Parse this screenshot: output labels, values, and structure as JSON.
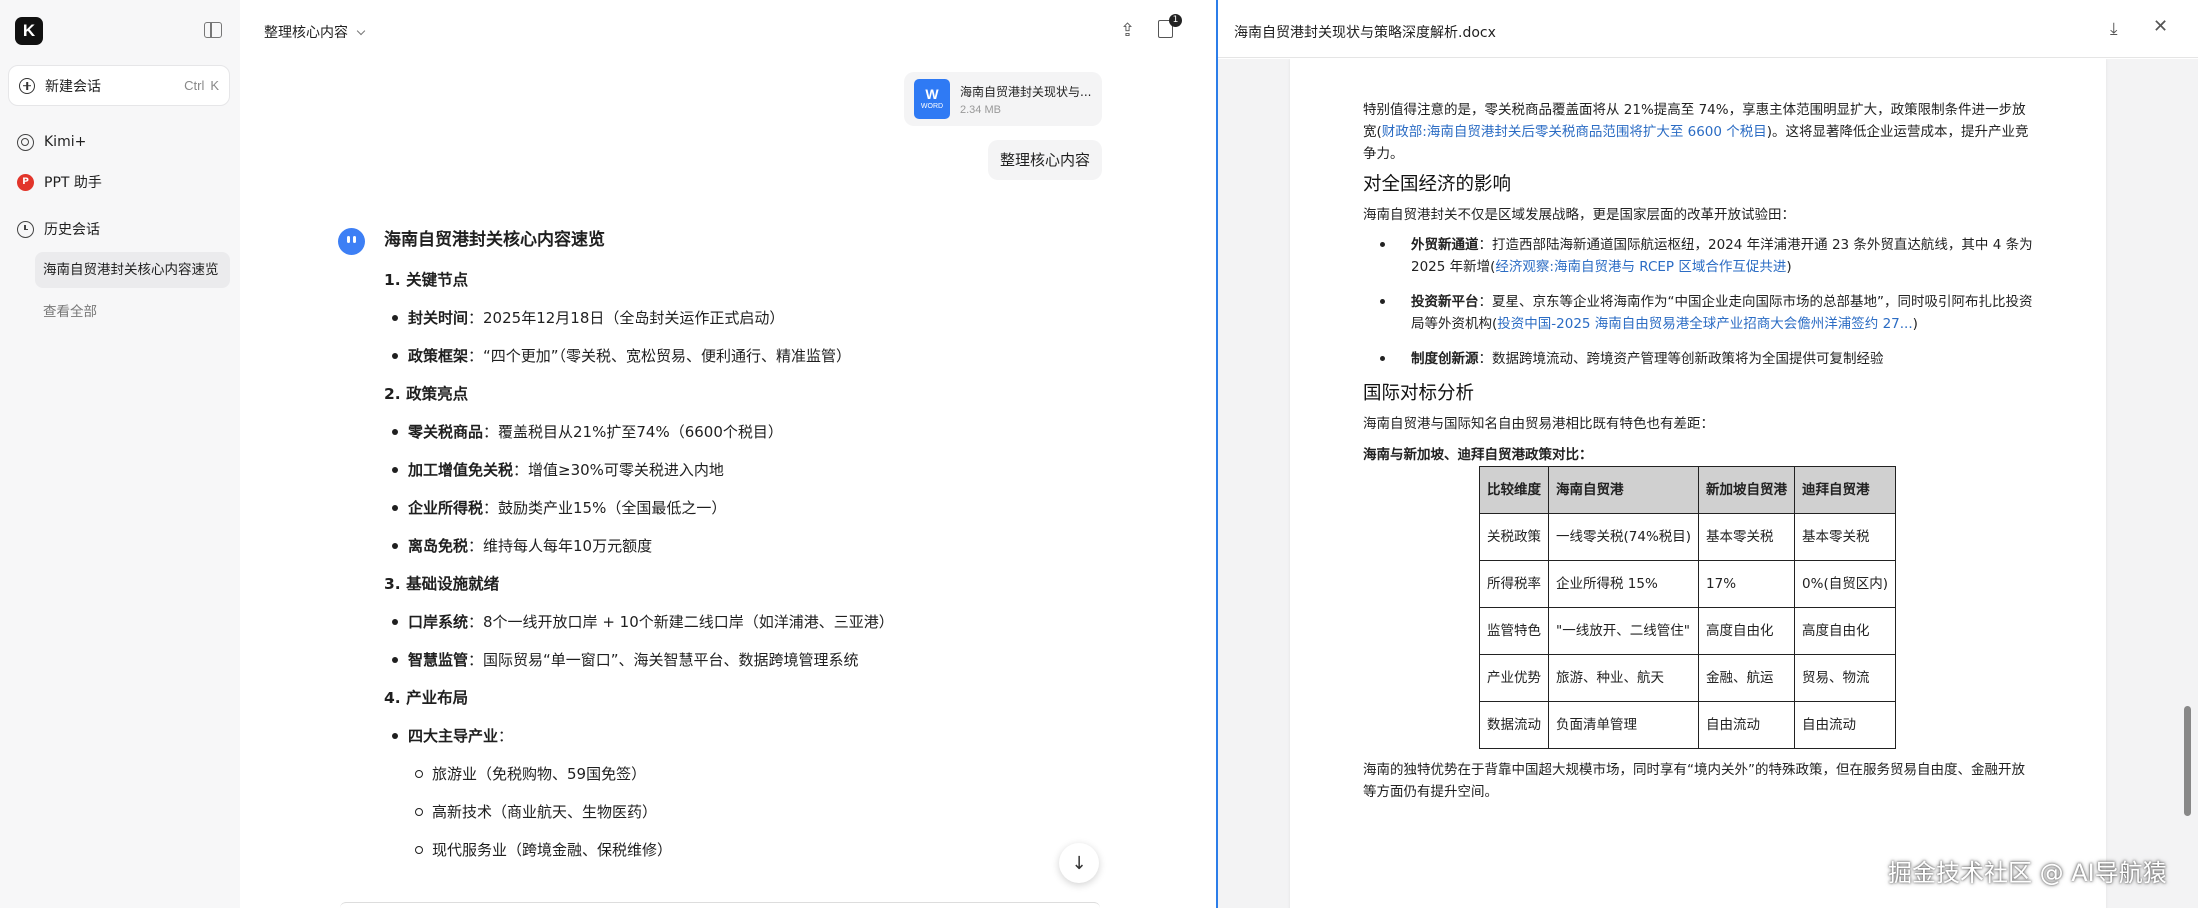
{
  "sidebar": {
    "logo": "K",
    "new_chat": {
      "label": "新建会话",
      "shortcut_mod": "Ctrl",
      "shortcut_key": "K"
    },
    "nav": [
      {
        "label": "Kimi+",
        "icon": "kimi-plus-icon"
      },
      {
        "label": "PPT 助手",
        "icon": "ppt-icon",
        "icon_glyph": "P"
      },
      {
        "label": "历史会话",
        "icon": "clock-icon"
      }
    ],
    "history_items": [
      "海南自贸港封关核心内容速览"
    ],
    "view_all": "查看全部"
  },
  "chat": {
    "title": "整理核心内容",
    "badge_count": "1",
    "file": {
      "icon_letter": "W",
      "icon_type": "WORD",
      "name": "海南自贸港封关现状与...",
      "size": "2.34 MB"
    },
    "user_message": "整理核心内容",
    "answer": {
      "title": "海南自贸港封关核心内容速览",
      "sections": [
        {
          "heading": "1. 关键节点",
          "items": [
            {
              "label": "封关时间",
              "text": "：2025年12月18日（全岛封关运作正式启动）"
            },
            {
              "label": "政策框架",
              "text": "：“四个更加”（零关税、宽松贸易、便利通行、精准监管）"
            }
          ]
        },
        {
          "heading": "2. 政策亮点",
          "items": [
            {
              "label": "零关税商品",
              "text": "：覆盖税目从21%扩至74%（6600个税目）"
            },
            {
              "label": "加工增值免关税",
              "text": "：增值≥30%可零关税进入内地"
            },
            {
              "label": "企业所得税",
              "text": "：鼓励类产业15%（全国最低之一）"
            },
            {
              "label": "离岛免税",
              "text": "：维持每人每年10万元额度"
            }
          ]
        },
        {
          "heading": "3. 基础设施就绪",
          "items": [
            {
              "label": "口岸系统",
              "text": "：8个一线开放口岸 + 10个新建二线口岸（如洋浦港、三亚港）"
            },
            {
              "label": "智慧监管",
              "text": "：国际贸易“单一窗口”、海关智慧平台、数据跨境管理系统"
            }
          ]
        },
        {
          "heading": "4. 产业布局",
          "items": [
            {
              "label": "四大主导产业",
              "text": "："
            }
          ],
          "subitems": [
            "旅游业（免税购物、59国免签）",
            "高新技术（商业航天、生物医药）",
            "现代服务业（跨境金融、保税维修）"
          ]
        }
      ]
    },
    "scroll_down_glyph": "↓"
  },
  "document": {
    "title": "海南自贸港封关现状与策略深度解析.docx",
    "close_glyph": "✕",
    "para1_pre": "特别值得注意的是，零关税商品覆盖面将从 21%提高至 74%，享惠主体范围明显扩大，政策限制条件进一步放宽(",
    "para1_link": "财政部:海南自贸港封关后零关税商品范围将扩大至 6600 个税目",
    "para1_post": ")。这将显著降低企业运营成本，提升产业竞争力。",
    "heading1": "对全国经济的影响",
    "intro1": "海南自贸港封关不仅是区域发展战略，更是国家层面的改革开放试验田：",
    "bullets": [
      {
        "label": "外贸新通道",
        "pre": "：打造西部陆海新通道国际航运枢纽，2024 年洋浦港开通 23 条外贸直达航线，其中 4 条为 2025 年新增(",
        "link": "经济观察:海南自贸港与 RCEP 区域合作互促共进",
        "post": ")"
      },
      {
        "label": "投资新平台",
        "pre": "：夏星、京东等企业将海南作为“中国企业走向国际市场的总部基地”，同时吸引阿布扎比投资局等外资机构(",
        "link": "投资中国-2025 海南自由贸易港全球产业招商大会儋州洋浦签约 27...",
        "post": ")"
      },
      {
        "label": "制度创新源",
        "pre": "：数据跨境流动、跨境资产管理等创新政策将为全国提供可复制经验",
        "link": "",
        "post": ""
      }
    ],
    "heading2": "国际对标分析",
    "intro2": "海南自贸港与国际知名自由贸易港相比既有特色也有差距：",
    "table_title": "海南与新加坡、迪拜自贸港政策对比：",
    "table": {
      "headers": [
        "比较维度",
        "海南自贸港",
        "新加坡自贸港",
        "迪拜自贸港"
      ],
      "rows": [
        [
          "关税政策",
          "一线零关税(74%税目)",
          "基本零关税",
          "基本零关税"
        ],
        [
          "所得税率",
          "企业所得税 15%",
          "17%",
          "0%(自贸区内)"
        ],
        [
          "监管特色",
          "\"一线放开、二线管住\"",
          "高度自由化",
          "高度自由化"
        ],
        [
          "产业优势",
          "旅游、种业、航天",
          "金融、航运",
          "贸易、物流"
        ],
        [
          "数据流动",
          "负面清单管理",
          "自由流动",
          "自由流动"
        ]
      ]
    },
    "closing": "海南的独特优势在于背靠中国超大规模市场，同时享有“境内关外”的特殊政策，但在服务贸易自由度、金融开放等方面仍有提升空间。"
  },
  "watermark": "掘金技术社区 @ AI导航猿",
  "colors": {
    "accent": "#2b7de9",
    "word_blue": "#2f7af4",
    "ppt_red": "#e2352b",
    "link": "#2b6cc4"
  }
}
